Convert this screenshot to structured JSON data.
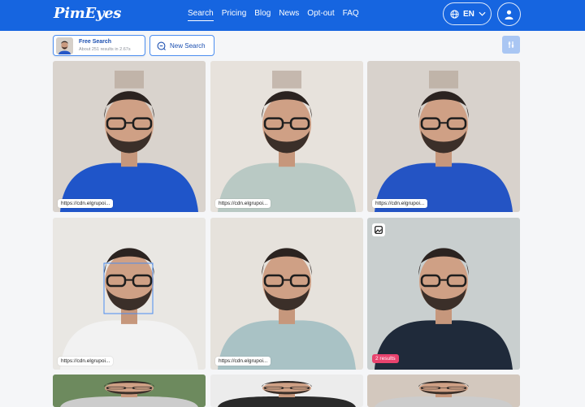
{
  "brand": {
    "logo_text": "PimEyes",
    "accent": "#1665e0"
  },
  "nav": {
    "items": [
      {
        "label": "Search",
        "active": true
      },
      {
        "label": "Pricing",
        "active": false
      },
      {
        "label": "Blog",
        "active": false
      },
      {
        "label": "News",
        "active": false
      },
      {
        "label": "Opt-out",
        "active": false
      },
      {
        "label": "FAQ",
        "active": false
      }
    ],
    "language": "EN"
  },
  "search": {
    "title": "Free Search",
    "subtitle": "About 251 results in 2.67s",
    "new_search_label": "New Search"
  },
  "results": [
    {
      "url": "https://cdn.elgrupoi...",
      "shirt": "#1f55c9",
      "bg": "#d9d3cd"
    },
    {
      "url": "https://cdn.elgrupoi...",
      "shirt": "#b9c9c4",
      "bg": "#e7e2dc"
    },
    {
      "url": "https://cdn.elgrupoi...",
      "shirt": "#2454c4",
      "bg": "#d8d2cc"
    },
    {
      "url": "https://cdn.elgrupoi...",
      "shirt": "#f2f2f2",
      "bg": "#e9e7e3"
    },
    {
      "url": "https://cdn.elgrupoi...",
      "shirt": "#a9c2c5",
      "bg": "#e6e2dc"
    },
    {
      "badge": "2 results",
      "shirt": "#1f2a3a",
      "bg": "#c9cfcf"
    },
    {
      "shirt": "#cccccc",
      "bg": "#6d8a5e"
    },
    {
      "shirt": "#2a2a2a",
      "bg": "#ececec"
    },
    {
      "shirt": "#cccccc",
      "bg": "#d3c8be"
    }
  ]
}
